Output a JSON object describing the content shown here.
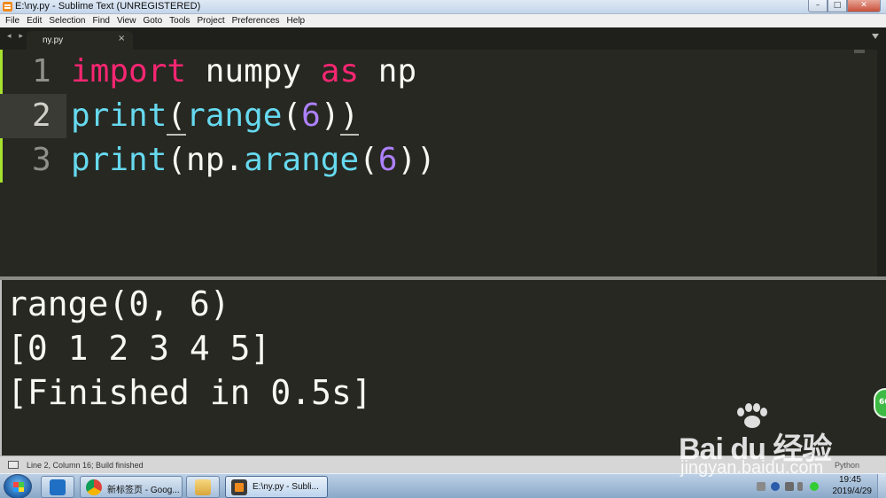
{
  "window": {
    "title": "E:\\ny.py - Sublime Text (UNREGISTERED)",
    "controls": {
      "minimize": "–",
      "maximize": "□",
      "close": "✕"
    }
  },
  "menu": [
    "File",
    "Edit",
    "Selection",
    "Find",
    "View",
    "Goto",
    "Tools",
    "Project",
    "Preferences",
    "Help"
  ],
  "tabs": {
    "nav": "◂ ▸",
    "active": {
      "label": "ny.py",
      "close": "×"
    }
  },
  "editor": {
    "lines": [
      {
        "number": "1",
        "tokens": [
          {
            "t": "import",
            "c": "kw"
          },
          {
            "t": " numpy ",
            "c": ""
          },
          {
            "t": "as",
            "c": "kw"
          },
          {
            "t": " np",
            "c": ""
          }
        ]
      },
      {
        "number": "2",
        "tokens": [
          {
            "t": "print",
            "c": "fn"
          },
          {
            "t": "(",
            "c": "bracket-u"
          },
          {
            "t": "range",
            "c": "fn"
          },
          {
            "t": "(",
            "c": ""
          },
          {
            "t": "6",
            "c": "num"
          },
          {
            "t": ")",
            "c": ""
          },
          {
            "t": ")",
            "c": "bracket-u"
          }
        ]
      },
      {
        "number": "3",
        "tokens": [
          {
            "t": "print",
            "c": "fn"
          },
          {
            "t": "(np.",
            "c": ""
          },
          {
            "t": "arange",
            "c": "fn"
          },
          {
            "t": "(",
            "c": ""
          },
          {
            "t": "6",
            "c": "num"
          },
          {
            "t": "))",
            "c": ""
          }
        ]
      }
    ],
    "current_line": 2
  },
  "output": {
    "lines": [
      "range(0, 6)",
      "[0 1 2 3 4 5]",
      "[Finished in 0.5s]"
    ],
    "bubble": "60"
  },
  "status": {
    "text": "Line 2, Column 16; Build finished",
    "syntax": "Python"
  },
  "taskbar": {
    "items": [
      {
        "label": "",
        "icon": "outlook-icon"
      },
      {
        "label": "新标签页 - Goog...",
        "icon": "chrome-icon"
      },
      {
        "label": "",
        "icon": "explorer-icon"
      },
      {
        "label": "E:\\ny.py - Subli...",
        "icon": "sublime-icon"
      }
    ],
    "clock": {
      "time": "19:45",
      "date": "2019/4/29"
    }
  },
  "watermark": {
    "brand": "Bai du 经验",
    "sub": "jingyan.baidu.com"
  },
  "colors": {
    "editor_bg": "#272822",
    "keyword": "#f92672",
    "function": "#66d9ef",
    "number": "#ae81ff",
    "text": "#f8f8f2"
  }
}
